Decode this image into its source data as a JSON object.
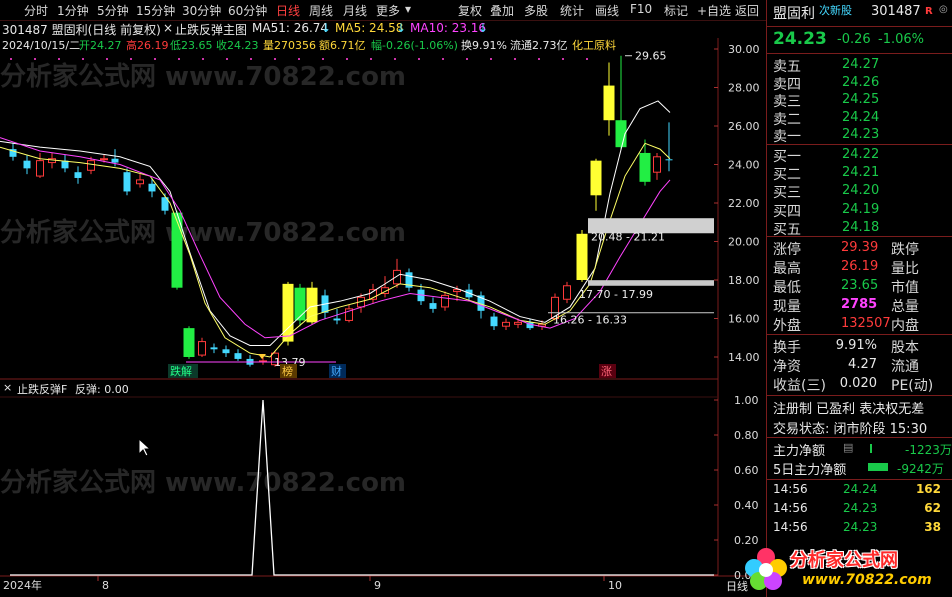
{
  "toolbar": {
    "timeframes": [
      "分时",
      "1分钟",
      "5分钟",
      "15分钟",
      "30分钟",
      "60分钟",
      "日线",
      "周线",
      "月线",
      "更多"
    ],
    "active": "日线",
    "stock_header": "301487 盟固利(日线 前复权)",
    "formula_name": "止跌反弹主图",
    "ma51": "MA51: 26.74",
    "ma5": "MA5: 24.58",
    "ma10": "MA10: 23.16",
    "tools": [
      "复权",
      "叠加",
      "多股",
      "统计",
      "画线",
      "F10",
      "标记",
      "+自选",
      "返回"
    ]
  },
  "info": {
    "date": "2024/10/15/二",
    "open": "开24.27",
    "high": "高26.19",
    "low": "低23.65",
    "close": "收24.23",
    "volume": "量270356",
    "amount": "额6.71亿",
    "change": "幅-0.26(-1.06%)",
    "turnover": "换9.91%",
    "float": "流通2.73亿",
    "industry": "化工原料"
  },
  "annotations": {
    "max_label": "29.65",
    "zone1": "20.48 - 21.21",
    "zone2": "17.70 - 17.99",
    "zone3": "16.26 - 16.33",
    "low_label": "13.79",
    "tag_diejie": "跌解",
    "tag_bang": "榜",
    "tag_cai": "财",
    "tag_zhang": "涨"
  },
  "price_axis": [
    "30.00",
    "28.00",
    "26.00",
    "24.00",
    "22.00",
    "20.00",
    "18.00",
    "16.00",
    "14.00"
  ],
  "sub": {
    "title": "止跌反弹F",
    "value": "反弹: 0.00",
    "axis": [
      "1.00",
      "0.80",
      "0.60",
      "0.40",
      "0.20",
      "0.00"
    ]
  },
  "time_axis": [
    "2024年",
    "8",
    "9",
    "10"
  ],
  "corner_label": "日线",
  "quote": {
    "name": "盟固利",
    "tag": "次新股",
    "code": "301487",
    "r_badge": "R",
    "price": "24.23",
    "change": "-0.26",
    "pct": "-1.06%",
    "asks": [
      {
        "label": "卖五",
        "price": "24.27"
      },
      {
        "label": "卖四",
        "price": "24.26"
      },
      {
        "label": "卖三",
        "price": "24.25"
      },
      {
        "label": "卖二",
        "price": "24.24"
      },
      {
        "label": "卖一",
        "price": "24.23"
      }
    ],
    "bids": [
      {
        "label": "买一",
        "price": "24.22"
      },
      {
        "label": "买二",
        "price": "24.21"
      },
      {
        "label": "买三",
        "price": "24.20"
      },
      {
        "label": "买四",
        "price": "24.19"
      },
      {
        "label": "买五",
        "price": "24.18"
      }
    ],
    "stats": [
      {
        "l": "涨停",
        "v": "29.39",
        "r": "跌停"
      },
      {
        "l": "最高",
        "v": "26.19",
        "r": "量比"
      },
      {
        "l": "最低",
        "v": "23.65",
        "r": "市值"
      },
      {
        "l": "现量",
        "v": "2785",
        "r": "总量"
      },
      {
        "l": "外盘",
        "v": "132507",
        "r": "内盘"
      }
    ],
    "stats2": [
      {
        "l": "换手",
        "v": "9.91%",
        "r": "股本"
      },
      {
        "l": "净资",
        "v": "4.27",
        "r": "流通"
      },
      {
        "l": "收益(三)",
        "v": "0.020",
        "r": "PE(动)"
      }
    ],
    "notes1": "注册制 已盈利 表决权无差",
    "notes2": "交易状态: 闭市阶段 15:30",
    "flow1_label": "主力净额",
    "flow1_val": "-1223万",
    "flow2_label": "5日主力净额",
    "flow2_val": "-9242万",
    "ticks": [
      {
        "t": "14:56",
        "p": "24.24",
        "v": "162"
      },
      {
        "t": "14:56",
        "p": "24.23",
        "v": "62"
      },
      {
        "t": "14:56",
        "p": "24.23",
        "v": "38"
      }
    ]
  },
  "watermark": {
    "text": "分析家公式网",
    "url": "www.70822.com",
    "bg1": "分析家公式网 www.70822.com"
  },
  "colors": {
    "up": "#ff3b3b",
    "down": "#19c94a",
    "ma5": "#ffff66",
    "ma10": "#ff43ff",
    "ma51": "#ffffff",
    "cyan": "#44d9ff"
  }
}
